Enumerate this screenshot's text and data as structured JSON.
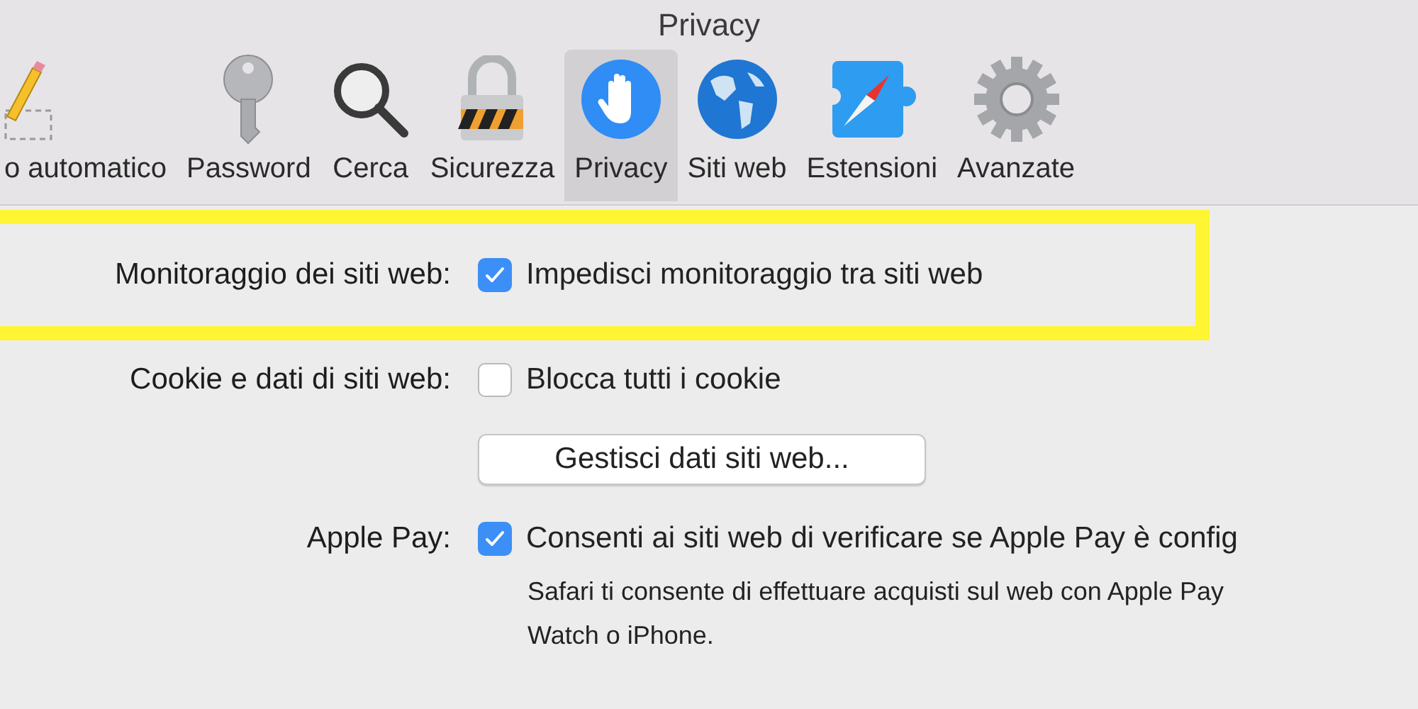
{
  "window": {
    "title": "Privacy"
  },
  "toolbar": [
    {
      "label": "o automatico",
      "selected": false
    },
    {
      "label": "Password",
      "selected": false
    },
    {
      "label": "Cerca",
      "selected": false
    },
    {
      "label": "Sicurezza",
      "selected": false
    },
    {
      "label": "Privacy",
      "selected": true
    },
    {
      "label": "Siti web",
      "selected": false
    },
    {
      "label": "Estensioni",
      "selected": false
    },
    {
      "label": "Avanzate",
      "selected": false
    }
  ],
  "settings": [
    {
      "kind": "checkbox",
      "label": "Monitoraggio dei siti web:",
      "text": "Impedisci monitoraggio tra siti web",
      "checked": true,
      "highlighted": true
    },
    {
      "kind": "checkbox",
      "label": "Cookie e dati di siti web:",
      "text": "Blocca tutti i cookie",
      "checked": false,
      "highlighted": false
    },
    {
      "kind": "button",
      "text": "Gestisci dati siti web..."
    },
    {
      "kind": "checkbox",
      "label": "Apple Pay:",
      "text": "Consenti ai siti web di verificare se Apple Pay è config",
      "checked": true,
      "highlighted": false,
      "note": "Safari ti consente di effettuare acquisti sul web con Apple Pay\nWatch o iPhone."
    }
  ]
}
